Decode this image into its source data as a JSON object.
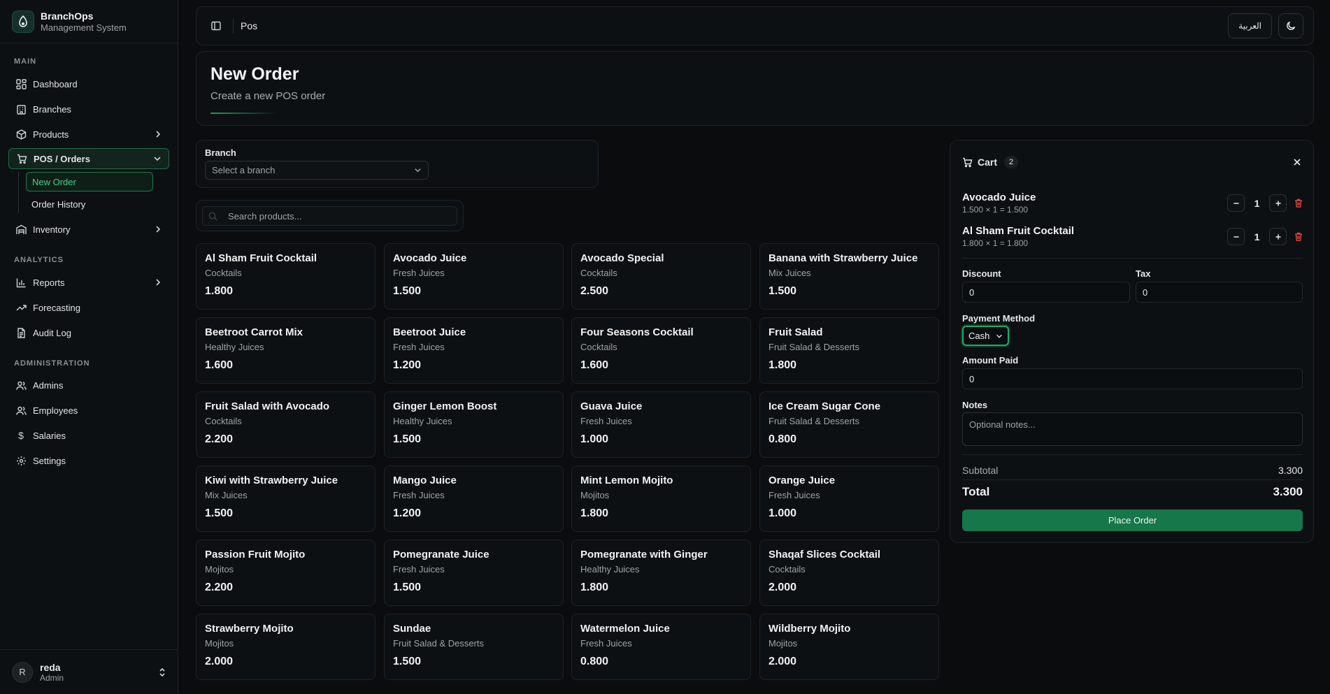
{
  "brand": {
    "title": "BranchOps",
    "subtitle": "Management System"
  },
  "sidebar": {
    "sections": {
      "main": "MAIN",
      "analytics": "ANALYTICS",
      "administration": "ADMINISTRATION"
    },
    "items": {
      "dashboard": "Dashboard",
      "branches": "Branches",
      "products": "Products",
      "pos_orders": "POS / Orders",
      "new_order": "New Order",
      "order_history": "Order History",
      "inventory": "Inventory",
      "reports": "Reports",
      "forecasting": "Forecasting",
      "audit_log": "Audit Log",
      "admins": "Admins",
      "employees": "Employees",
      "salaries": "Salaries",
      "settings": "Settings"
    },
    "user": {
      "initial": "R",
      "name": "reda",
      "role": "Admin"
    }
  },
  "topbar": {
    "breadcrumb": "Pos",
    "language_button": "العربية"
  },
  "page": {
    "title": "New Order",
    "subtitle": "Create a new POS order"
  },
  "branch": {
    "label": "Branch",
    "placeholder": "Select a branch"
  },
  "search": {
    "placeholder": "Search products..."
  },
  "products": [
    {
      "name": "Al Sham Fruit Cocktail",
      "category": "Cocktails",
      "price": "1.800"
    },
    {
      "name": "Avocado Juice",
      "category": "Fresh Juices",
      "price": "1.500"
    },
    {
      "name": "Avocado Special",
      "category": "Cocktails",
      "price": "2.500"
    },
    {
      "name": "Banana with Strawberry Juice",
      "category": "Mix Juices",
      "price": "1.500"
    },
    {
      "name": "Beetroot Carrot Mix",
      "category": "Healthy Juices",
      "price": "1.600"
    },
    {
      "name": "Beetroot Juice",
      "category": "Fresh Juices",
      "price": "1.200"
    },
    {
      "name": "Four Seasons Cocktail",
      "category": "Cocktails",
      "price": "1.600"
    },
    {
      "name": "Fruit Salad",
      "category": "Fruit Salad & Desserts",
      "price": "1.800"
    },
    {
      "name": "Fruit Salad with Avocado",
      "category": "Cocktails",
      "price": "2.200"
    },
    {
      "name": "Ginger Lemon Boost",
      "category": "Healthy Juices",
      "price": "1.500"
    },
    {
      "name": "Guava Juice",
      "category": "Fresh Juices",
      "price": "1.000"
    },
    {
      "name": "Ice Cream Sugar Cone",
      "category": "Fruit Salad & Desserts",
      "price": "0.800"
    },
    {
      "name": "Kiwi with Strawberry Juice",
      "category": "Mix Juices",
      "price": "1.500"
    },
    {
      "name": "Mango Juice",
      "category": "Fresh Juices",
      "price": "1.200"
    },
    {
      "name": "Mint Lemon Mojito",
      "category": "Mojitos",
      "price": "1.800"
    },
    {
      "name": "Orange Juice",
      "category": "Fresh Juices",
      "price": "1.000"
    },
    {
      "name": "Passion Fruit Mojito",
      "category": "Mojitos",
      "price": "2.200"
    },
    {
      "name": "Pomegranate Juice",
      "category": "Fresh Juices",
      "price": "1.500"
    },
    {
      "name": "Pomegranate with Ginger",
      "category": "Healthy Juices",
      "price": "1.800"
    },
    {
      "name": "Shaqaf Slices Cocktail",
      "category": "Cocktails",
      "price": "2.000"
    },
    {
      "name": "Strawberry Mojito",
      "category": "Mojitos",
      "price": "2.000"
    },
    {
      "name": "Sundae",
      "category": "Fruit Salad & Desserts",
      "price": "1.500"
    },
    {
      "name": "Watermelon Juice",
      "category": "Fresh Juices",
      "price": "0.800"
    },
    {
      "name": "Wildberry Mojito",
      "category": "Mojitos",
      "price": "2.000"
    }
  ],
  "cart": {
    "title": "Cart",
    "count": "2",
    "items": [
      {
        "name": "Avocado Juice",
        "calc": "1.500 × 1 = 1.500",
        "qty": "1"
      },
      {
        "name": "Al Sham Fruit Cocktail",
        "calc": "1.800 × 1 = 1.800",
        "qty": "1"
      }
    ],
    "discount_label": "Discount",
    "discount_value": "0",
    "tax_label": "Tax",
    "tax_value": "0",
    "payment_label": "Payment Method",
    "payment_value": "Cash",
    "amount_paid_label": "Amount Paid",
    "amount_paid_value": "0",
    "notes_label": "Notes",
    "notes_placeholder": "Optional notes...",
    "subtotal_label": "Subtotal",
    "subtotal_value": "3.300",
    "total_label": "Total",
    "total_value": "3.300",
    "place_order": "Place Order"
  },
  "colors": {
    "accent": "#16774a",
    "accent_bright": "#43d18a",
    "danger": "#e0443e",
    "background": "#0a0c0e",
    "card": "#0d1012"
  }
}
